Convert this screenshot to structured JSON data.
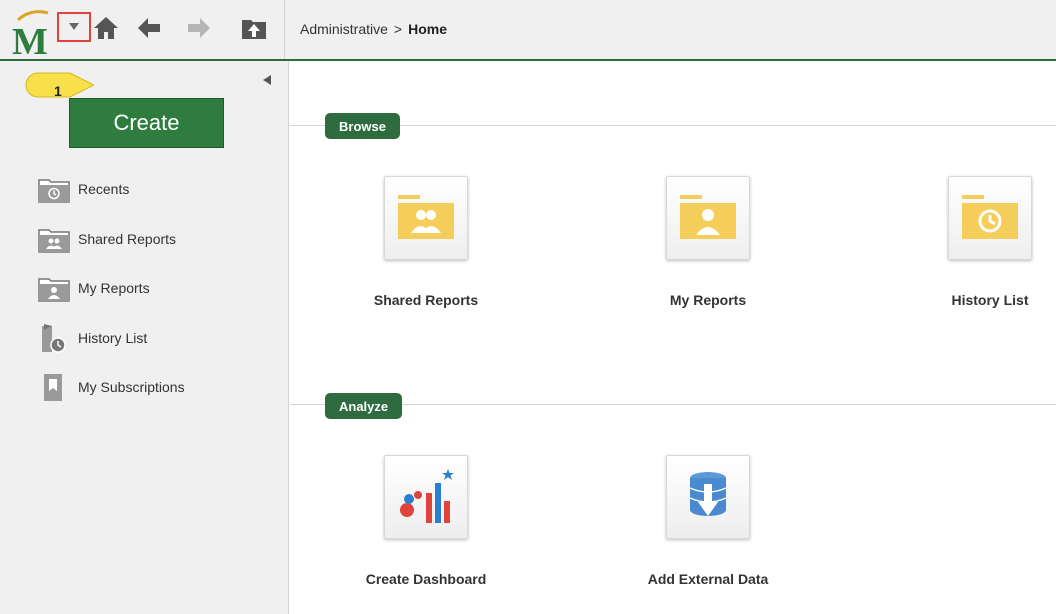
{
  "toolbar": {
    "logo_text": "M",
    "breadcrumb": {
      "parent": "Administrative",
      "separator": ">",
      "current": "Home"
    }
  },
  "callout": {
    "number": "1"
  },
  "sidebar": {
    "create_label": "Create",
    "items": [
      {
        "label": "Recents",
        "icon": "recents-folder-icon"
      },
      {
        "label": "Shared Reports",
        "icon": "shared-reports-folder-icon"
      },
      {
        "label": "My Reports",
        "icon": "my-reports-folder-icon"
      },
      {
        "label": "History List",
        "icon": "history-list-icon"
      },
      {
        "label": "My Subscriptions",
        "icon": "subscriptions-icon"
      }
    ]
  },
  "main": {
    "browse": {
      "title": "Browse",
      "tiles": [
        {
          "label": "Shared Reports",
          "icon": "shared-reports-folder-icon"
        },
        {
          "label": "My Reports",
          "icon": "my-reports-folder-icon"
        },
        {
          "label": "History List",
          "icon": "history-list-folder-icon"
        }
      ]
    },
    "analyze": {
      "title": "Analyze",
      "tiles": [
        {
          "label": "Create Dashboard",
          "icon": "dashboard-chart-icon"
        },
        {
          "label": "Add External Data",
          "icon": "database-import-icon"
        }
      ]
    }
  },
  "colors": {
    "accent_green": "#2e6b3e",
    "create_green": "#2e7d3f",
    "folder_yellow": "#f5cd5b",
    "highlight_red": "#e0433b",
    "callout_yellow": "#f7e04a"
  }
}
